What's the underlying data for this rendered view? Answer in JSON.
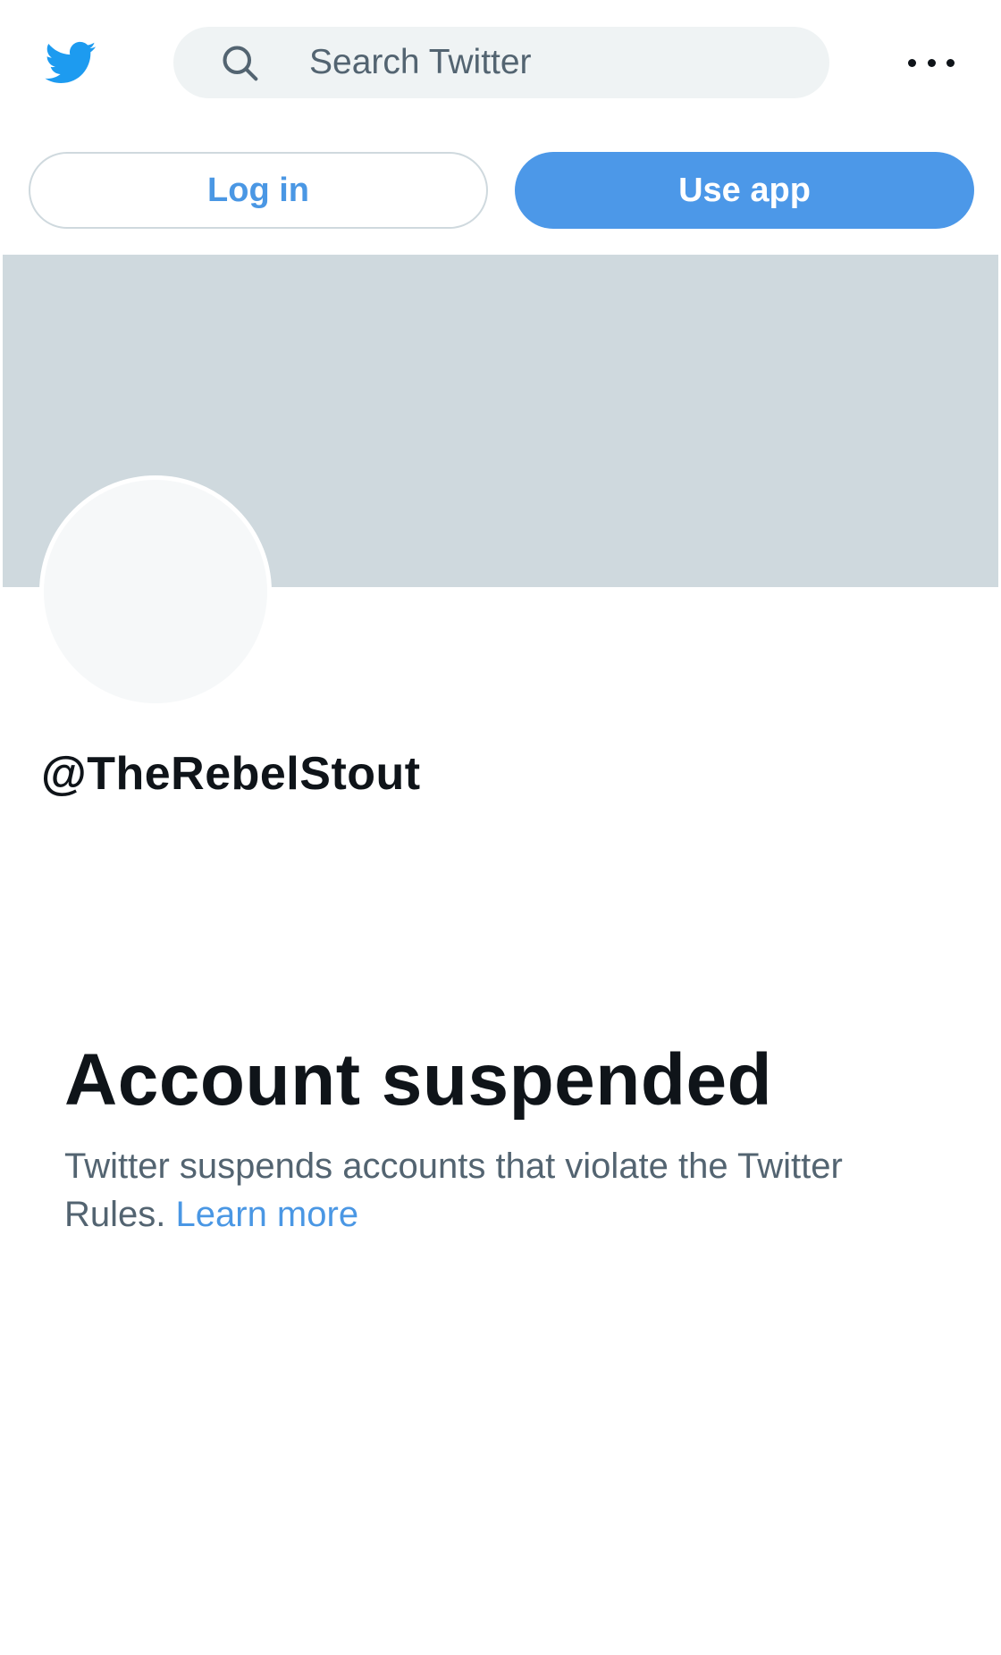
{
  "header": {
    "logo_icon": "twitter-bird-icon",
    "search": {
      "placeholder": "Search Twitter",
      "icon": "search-icon"
    },
    "more_icon": "more-horizontal-icon"
  },
  "actions": {
    "login_label": "Log in",
    "use_app_label": "Use app"
  },
  "profile": {
    "handle": "@TheRebelStout"
  },
  "suspension": {
    "title": "Account suspended",
    "body": "Twitter suspends accounts that violate the Twitter Rules.",
    "link_label": "Learn more"
  },
  "colors": {
    "brand_blue": "#1d9bf0",
    "button_blue": "#4c98e8",
    "link_blue": "#4a97e4",
    "banner_gray": "#cfd9de",
    "search_bg": "#eff3f4",
    "secondary_text": "#536471",
    "primary_text": "#0f1419"
  }
}
